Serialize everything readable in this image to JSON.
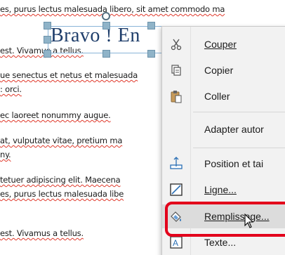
{
  "document": {
    "lines": [
      "es, purus lectus malesuada libero, sit amet commodo ma",
      "est. Vivamus a tellus.",
      "ue senectus et netus et malesuada",
      ": orci.",
      "ec laoreet nonummy augue.",
      "at, vulputate vitae, pretium ma",
      "ny.",
      "tetuer adipiscing elit. Maecena",
      "es, purus lectus malesuada libe",
      "est. Vivamus a tellus."
    ],
    "textbox_text": "Bravo ! En"
  },
  "context_menu": {
    "items": [
      {
        "label": "Couper",
        "icon": "scissors-icon",
        "accel": "C"
      },
      {
        "label": "Copier",
        "icon": "copy-icon",
        "accel": "p"
      },
      {
        "label": "Coller",
        "icon": "paste-icon",
        "accel": "o"
      },
      {
        "label": "Adapter autor",
        "icon": "",
        "accel": ""
      },
      {
        "label": "Position et tai",
        "icon": "position-icon",
        "accel": ""
      },
      {
        "label": "Ligne...",
        "icon": "line-icon",
        "accel": "L"
      },
      {
        "label": "Remplissage...",
        "icon": "fill-icon",
        "accel": "R"
      },
      {
        "label": "Texte...",
        "icon": "text-icon",
        "accel": "T"
      }
    ]
  },
  "colors": {
    "highlight": "#e3001b",
    "spellcheck": "#e0392b",
    "selection_handle": "#8fb3c8"
  }
}
